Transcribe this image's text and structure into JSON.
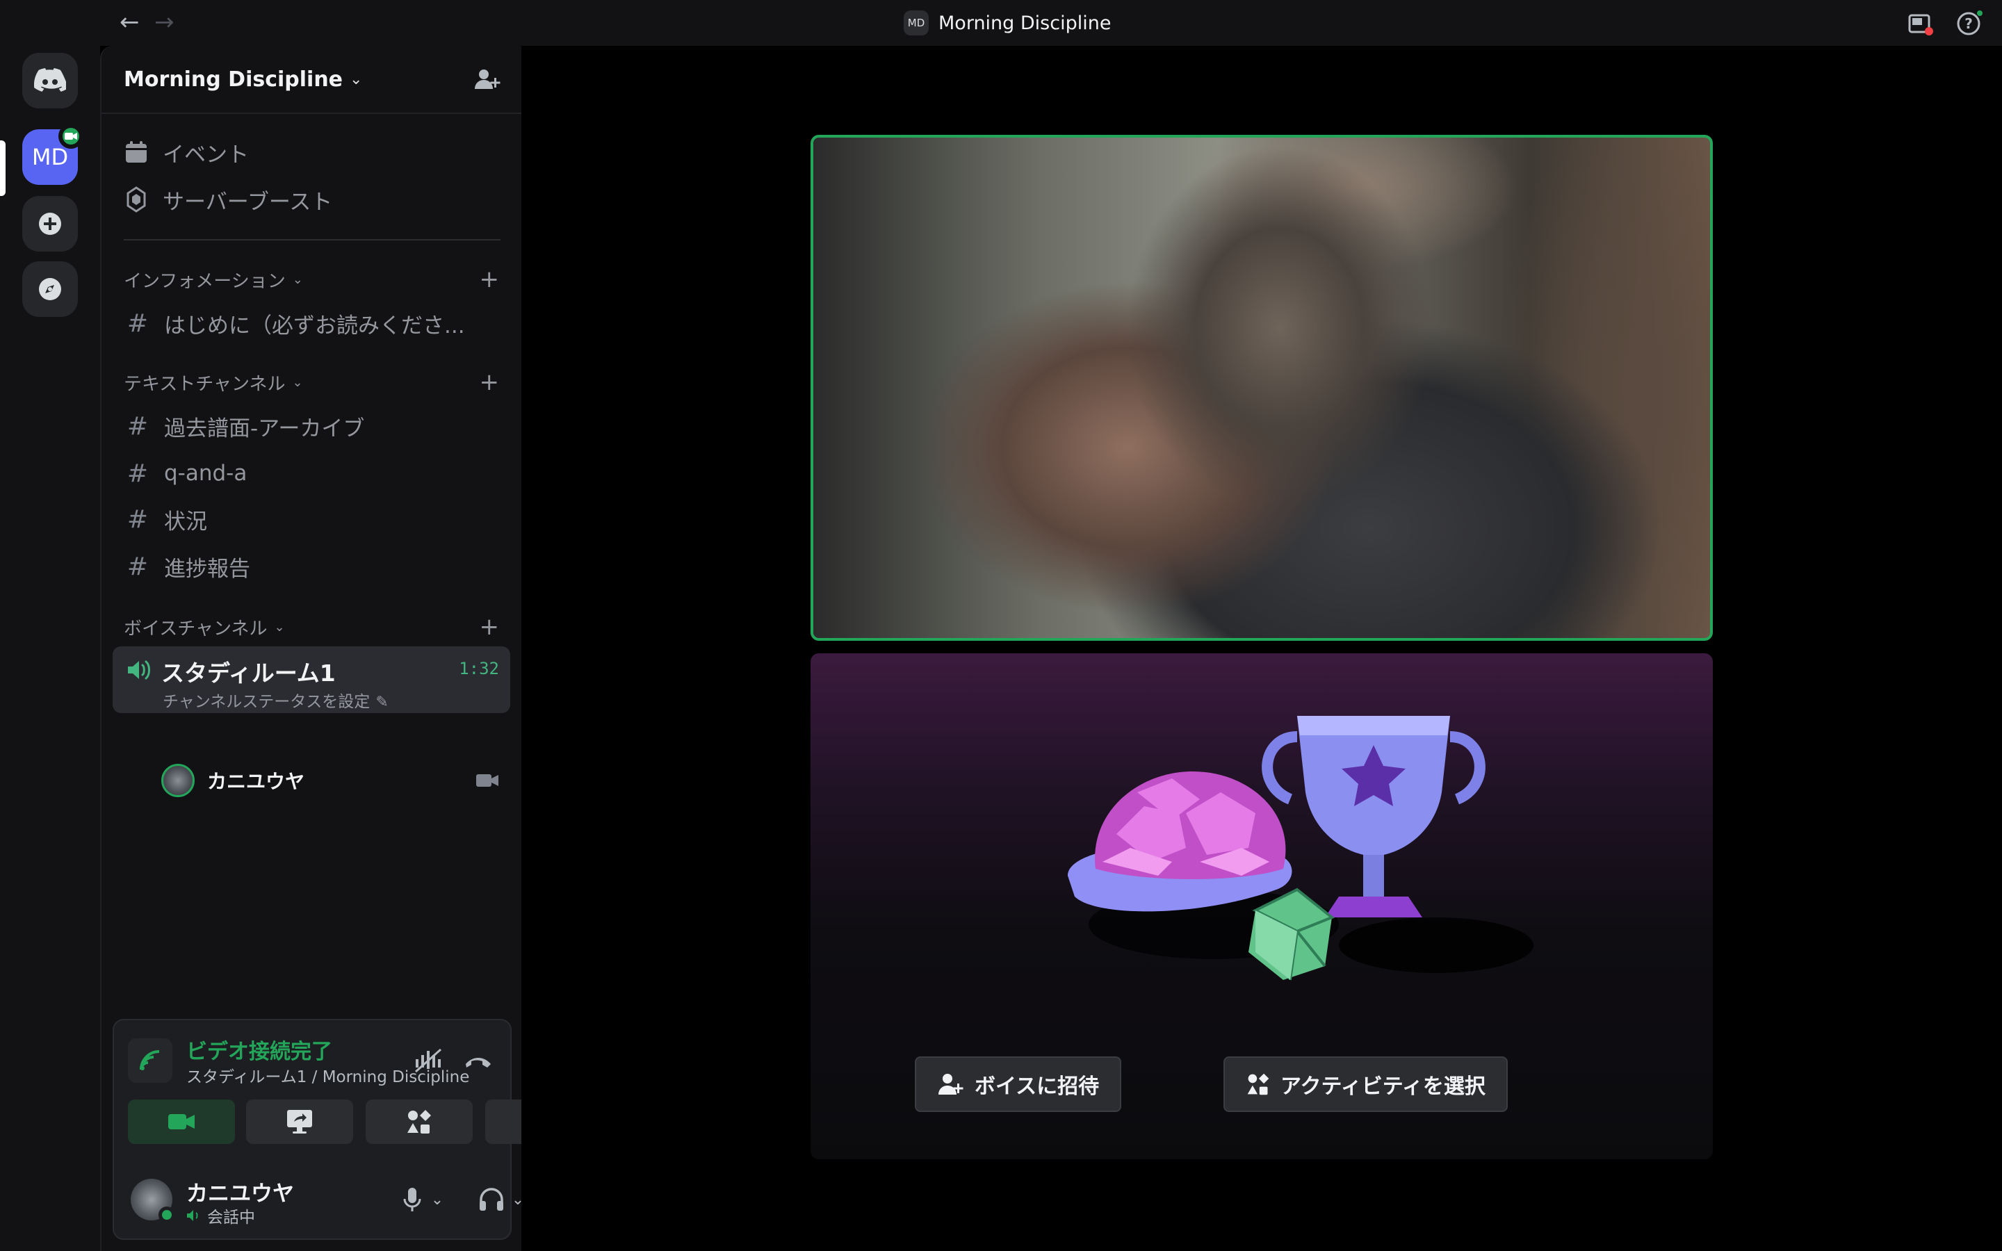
{
  "titlebar": {
    "back": "←",
    "forward": "→",
    "server_badge": "MD",
    "title": "Morning Discipline"
  },
  "rail": {
    "server_initials": "MD"
  },
  "sidebar": {
    "server_name": "Morning Discipline",
    "top_items": [
      {
        "label": "イベント",
        "icon": "calendar-icon"
      },
      {
        "label": "サーバーブースト",
        "icon": "boost-icon"
      }
    ],
    "categories": {
      "info": "インフォメーション",
      "text": "テキストチャンネル",
      "voice": "ボイスチャンネル"
    },
    "info_channels": [
      "はじめに（必ずお読みくださ..."
    ],
    "text_channels": [
      "過去譜面-アーカイブ",
      "q-and-a",
      "状況",
      "進捗報告"
    ],
    "voice_channel": {
      "name": "スタディルーム1",
      "time": "1:32",
      "status": "チャンネルステータスを設定"
    },
    "voice_user": "カニユウヤ"
  },
  "panel": {
    "connection_title": "ビデオ接続完了",
    "connection_sub": "スタディルーム1 / Morning Discipline",
    "user_name": "カニユウヤ",
    "user_state": "会話中"
  },
  "stage": {
    "invite_button": "ボイスに招待",
    "activity_button": "アクティビティを選択"
  },
  "colors": {
    "accent_green": "#23a55a",
    "blurple": "#5865f2",
    "background": "#121214"
  }
}
